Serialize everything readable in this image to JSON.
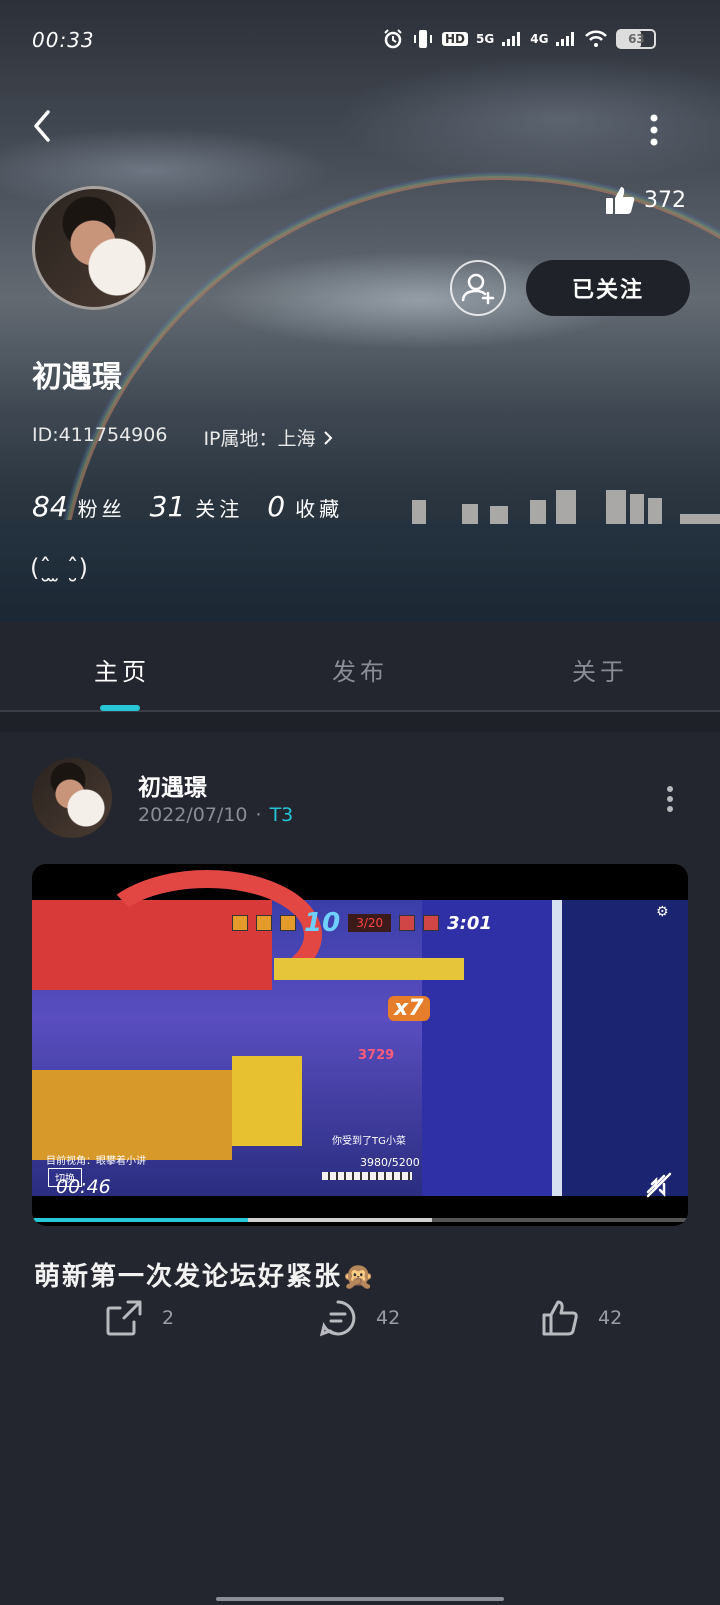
{
  "status_bar": {
    "time": "00:33",
    "hd": "HD",
    "net_5g": "5G",
    "net_4g": "4G",
    "battery": "63"
  },
  "profile": {
    "like_count": "372",
    "follow_label": "已关注",
    "username": "初遇璟",
    "id_text": "ID:411754906",
    "ip_text": "IP属地：上海",
    "stats": {
      "fans_num": "84",
      "fans_label": "粉丝",
      "following_num": "31",
      "following_label": "关注",
      "fav_num": "0",
      "fav_label": "收藏"
    },
    "bio": "(ˆ̮ ̫ ˆ̮)"
  },
  "tabs": [
    "主页",
    "发布",
    "关于"
  ],
  "active_tab": 0,
  "post": {
    "author": "初遇璟",
    "date": "2022/07/10",
    "separator": "·",
    "tag": "T3",
    "video": {
      "time": "00:46",
      "played_fraction": 0.33,
      "buffered_fraction": 0.61,
      "hud": {
        "team_score": "10",
        "enemy_score": "3/20",
        "timer": "3:01",
        "combo": "x7",
        "damage": "3729",
        "hp": "3980/5200",
        "kill_msg": "你受到了TG小菜",
        "left_info": "目前视角：眼攀着小讲",
        "switch_label": "切换"
      }
    },
    "text": "萌新第一次发论坛好紧张🙊",
    "share_count": "2",
    "comment_count": "42",
    "like_count": "42"
  },
  "colors": {
    "accent": "#26c6d6",
    "background": "#24262f",
    "muted_text": "#8a8d95"
  },
  "icons": [
    "back-arrow-icon",
    "more-vertical-icon",
    "thumb-up-icon",
    "add-friend-icon",
    "share-icon",
    "comment-icon",
    "mute-icon"
  ]
}
